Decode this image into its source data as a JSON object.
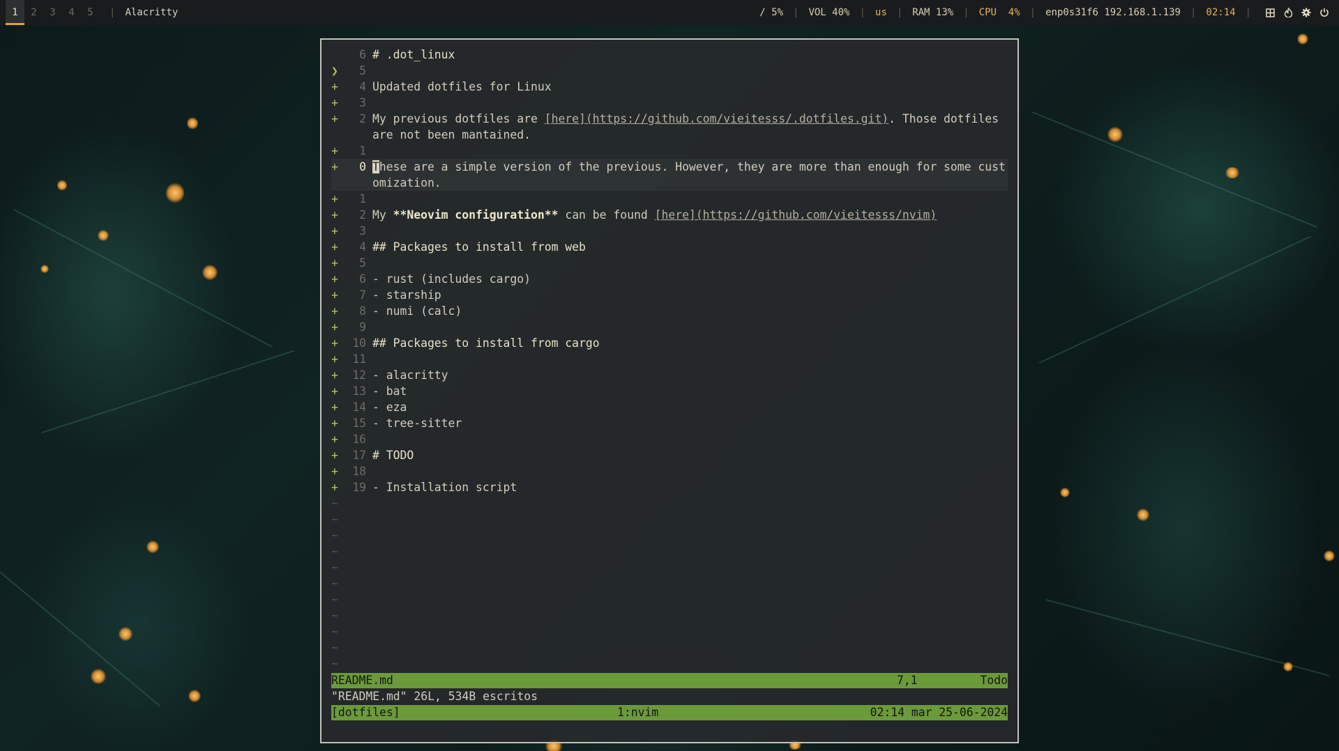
{
  "topbar": {
    "workspaces": [
      "1",
      "2",
      "3",
      "4",
      "5"
    ],
    "active_workspace": "1",
    "window_title": "Alacritty",
    "disk": "/ 5%",
    "volume": "VOL 40%",
    "layout": "us",
    "ram": "RAM 13%",
    "cpu": "CPU  4%",
    "network": "enp0s31f6 192.168.1.139",
    "clock": "02:14",
    "tray_icons": [
      "grid-icon",
      "flame-icon",
      "gear-icon",
      "power-icon"
    ],
    "accent_color": "#e0a03a"
  },
  "editor": {
    "lines": [
      {
        "sign": "",
        "num": "6",
        "text": "# .dot_linux"
      },
      {
        "sign": "❯",
        "num": "5",
        "text": ""
      },
      {
        "sign": "+",
        "num": "4",
        "text": "Updated dotfiles for Linux"
      },
      {
        "sign": "+",
        "num": "3",
        "text": ""
      },
      {
        "sign": "+",
        "num": "2",
        "text_pre": "My previous dotfiles are ",
        "link": "[here](https://github.com/vieitesss/.dotfiles.git)",
        "text_post": ". Those dotfiles",
        "wrap": "are not been mantained."
      },
      {
        "sign": "+",
        "num": "1",
        "text": ""
      },
      {
        "sign": "+",
        "num": "0",
        "cursor": "T",
        "text": "hese are a simple version of the previous. However, they are more than enough for some cust",
        "wrap": "omization."
      },
      {
        "sign": "+",
        "num": "1",
        "text": ""
      },
      {
        "sign": "+",
        "num": "2",
        "text_pre": "My ",
        "bold": "**Neovim configuration**",
        "text_mid": " can be found ",
        "link": "[here](https://github.com/vieitesss/nvim)"
      },
      {
        "sign": "+",
        "num": "3",
        "text": ""
      },
      {
        "sign": "+",
        "num": "4",
        "text": "## Packages to install from web"
      },
      {
        "sign": "+",
        "num": "5",
        "text": ""
      },
      {
        "sign": "+",
        "num": "6",
        "text": "- rust (includes cargo)"
      },
      {
        "sign": "+",
        "num": "7",
        "text": "- starship"
      },
      {
        "sign": "+",
        "num": "8",
        "text": "- numi (calc)"
      },
      {
        "sign": "+",
        "num": "9",
        "text": ""
      },
      {
        "sign": "+",
        "num": "10",
        "text": "## Packages to install from cargo"
      },
      {
        "sign": "+",
        "num": "11",
        "text": ""
      },
      {
        "sign": "+",
        "num": "12",
        "text": "- alacritty"
      },
      {
        "sign": "+",
        "num": "13",
        "text": "- bat"
      },
      {
        "sign": "+",
        "num": "14",
        "text": "- eza"
      },
      {
        "sign": "+",
        "num": "15",
        "text": "- tree-sitter"
      },
      {
        "sign": "+",
        "num": "16",
        "text": ""
      },
      {
        "sign": "+",
        "num": "17",
        "text": "# TODO"
      },
      {
        "sign": "+",
        "num": "18",
        "text": ""
      },
      {
        "sign": "+",
        "num": "19",
        "text": "- Installation script"
      }
    ],
    "tilde_count": 11,
    "tilde_char": "~",
    "statusline": {
      "filename": "README.md",
      "position": "7,1",
      "scroll": "Todo",
      "color": "#6b9a3a"
    },
    "cmdline": "\"README.md\" 26L, 534B escritos",
    "tmux": {
      "session": "[dotfiles]",
      "window": "1:nvim",
      "datetime": "02:14 mar 25-06-2024"
    }
  }
}
